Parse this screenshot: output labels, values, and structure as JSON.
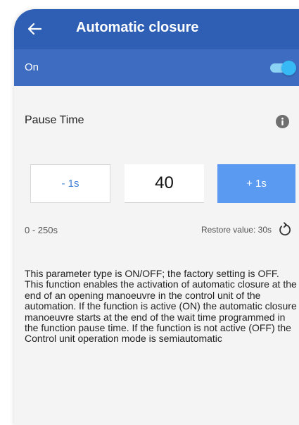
{
  "header": {
    "title": "Automatic closure"
  },
  "toggle": {
    "label": "On",
    "state": true
  },
  "pause_time": {
    "title": "Pause Time",
    "decrement_label": "- 1s",
    "value": "40",
    "increment_label": "+ 1s",
    "range": "0 - 250s",
    "restore_label": "Restore value: 30s"
  },
  "description": "This parameter type is ON/OFF; the factory setting is OFF. This function enables the activation of automatic closure at the end of an opening manoeuvre in the control unit of the automation. If the function is active (ON) the automatic closure manoeuvre starts at the end of the wait time programmed in the function pause time. If the function is not active (OFF) the Control unit operation mode is semiautomatic",
  "icons": {
    "back": "arrow-left-icon",
    "info": "info-icon",
    "restore": "restore-icon"
  },
  "colors": {
    "appbar": "#2e5fb4",
    "toggle_row": "#3d6cc0",
    "switch_on": "#36b9f4",
    "increment_button": "#5a9af1",
    "decrement_text": "#3f7fd6",
    "background": "#f4f4f4"
  }
}
